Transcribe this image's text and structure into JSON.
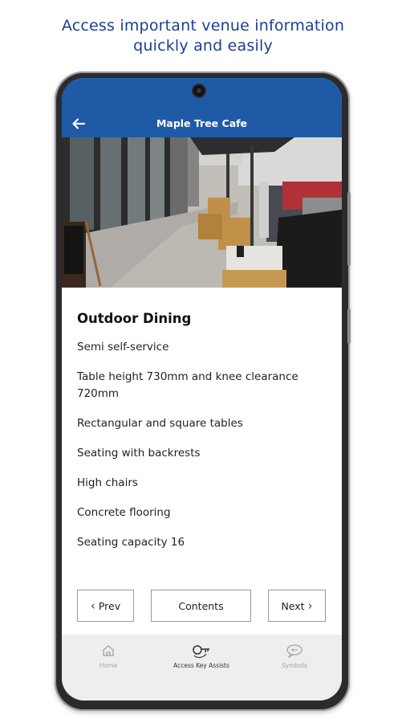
{
  "headline": {
    "line1": "Access important venue information",
    "line2": "quickly and easily"
  },
  "appbar": {
    "title": "Maple Tree Cafe",
    "background": "#1f5aa6"
  },
  "photo_icon": "outdoor-dining-photo",
  "section": {
    "title": "Outdoor Dining",
    "features": [
      "Semi self-service",
      "Table height 730mm and knee clearance 720mm",
      "Rectangular and square tables",
      "Seating with backrests",
      "High chairs",
      "Concrete flooring",
      "Seating capacity 16"
    ]
  },
  "buttons": {
    "prev": "Prev",
    "contents": "Contents",
    "next": "Next"
  },
  "bottom_nav": {
    "items": [
      {
        "label": "Home",
        "icon": "home-icon",
        "active": false
      },
      {
        "label": "Access Key Assists",
        "icon": "access-key-icon",
        "active": true
      },
      {
        "label": "Symbols",
        "icon": "symbols-icon",
        "active": false
      }
    ]
  },
  "colors": {
    "headline": "#1d3f8f",
    "accent": "#1f5aa6",
    "inactive_tab": "#a2a2a2"
  }
}
